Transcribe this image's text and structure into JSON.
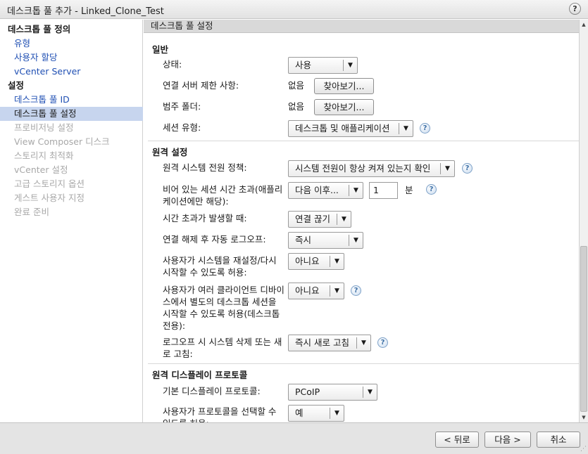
{
  "window": {
    "title": "데스크톱 풀 추가 - Linked_Clone_Test",
    "help_symbol": "?"
  },
  "sidebar": {
    "items": [
      {
        "label": "데스크톱 풀 정의",
        "state": "heading"
      },
      {
        "label": "유형",
        "state": "link"
      },
      {
        "label": "사용자 할당",
        "state": "link"
      },
      {
        "label": "vCenter Server",
        "state": "link"
      },
      {
        "label": "설정",
        "state": "heading"
      },
      {
        "label": "데스크톱 풀 ID",
        "state": "link"
      },
      {
        "label": "데스크톱 풀 설정",
        "state": "active"
      },
      {
        "label": "프로비저닝 설정",
        "state": "disabled"
      },
      {
        "label": "View Composer 디스크",
        "state": "disabled"
      },
      {
        "label": "스토리지 최적화",
        "state": "disabled"
      },
      {
        "label": "vCenter 설정",
        "state": "disabled"
      },
      {
        "label": "고급 스토리지 옵션",
        "state": "disabled"
      },
      {
        "label": "게스트 사용자 지정",
        "state": "disabled"
      },
      {
        "label": "완료 준비",
        "state": "disabled"
      }
    ]
  },
  "content": {
    "header": "데스크톱 풀 설정",
    "general": {
      "title": "일반",
      "state_label": "상태:",
      "state_value": "사용",
      "conn_restrict_label": "연결 서버 제한 사항:",
      "conn_restrict_value": "없음",
      "category_label": "범주 폴더:",
      "category_value": "없음",
      "browse_label": "찾아보기...",
      "session_type_label": "세션 유형:",
      "session_type_value": "데스크톱 및 애플리케이션"
    },
    "remote": {
      "title": "원격 설정",
      "power_policy_label": "원격 시스템 전원 정책:",
      "power_policy_value": "시스템 전원이 항상 켜져 있는지 확인",
      "idle_timeout_label": "비어 있는 세션 시간 초과(애플리케이션에만 해당):",
      "idle_timeout_value": "다음 이후...",
      "idle_timeout_amount": "1",
      "idle_timeout_unit": "분",
      "on_timeout_label": "시간 초과가 발생할 때:",
      "on_timeout_value": "연결 끊기",
      "auto_logoff_label": "연결 해제 후 자동 로그오프:",
      "auto_logoff_value": "즉시",
      "allow_reset_label": "사용자가 시스템을 재설정/다시 시작할 수 있도록 허용:",
      "allow_reset_value": "아니요",
      "multi_session_label": "사용자가 여러 클라이언트 디바이스에서 별도의 데스크톱 세션을 시작할 수 있도록 허용(데스크톱 전용):",
      "multi_session_value": "아니요",
      "refresh_label": "로그오프 시 시스템 삭제 또는 새로 고침:",
      "refresh_value": "즉시 새로 고침"
    },
    "display": {
      "title": "원격 디스플레이 프로토콜",
      "default_protocol_label": "기본 디스플레이 프로토콜:",
      "default_protocol_value": "PCoIP",
      "allow_choose_label": "사용자가 프로토콜을 선택할 수 있도록 허용:",
      "allow_choose_value": "예"
    }
  },
  "footer": {
    "back_label": "< 뒤로",
    "next_label": "다음 >",
    "cancel_label": "취소"
  }
}
